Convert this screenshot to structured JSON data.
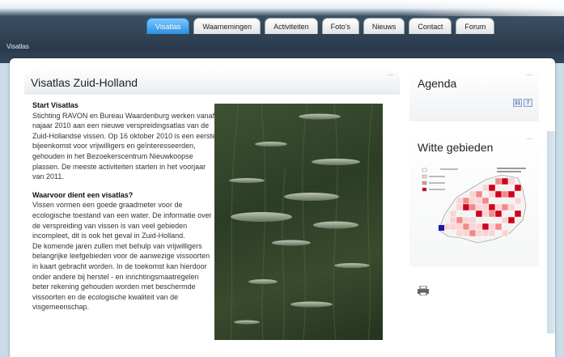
{
  "nav": {
    "tabs": [
      {
        "label": "Visatlas",
        "active": true
      },
      {
        "label": "Waarnemingen",
        "active": false
      },
      {
        "label": "Activiteiten",
        "active": false
      },
      {
        "label": "Foto's",
        "active": false
      },
      {
        "label": "Nieuws",
        "active": false
      },
      {
        "label": "Contact",
        "active": false
      },
      {
        "label": "Forum",
        "active": false
      }
    ]
  },
  "site_label": "Visatlas",
  "main": {
    "title": "Visatlas Zuid-Holland",
    "section1": {
      "heading": "Start Visatlas",
      "body": "Stichting RAVON en Bureau Waardenburg werken vanaf najaar 2010 aan een nieuwe verspreidingsatlas van de Zuid-Hollandse vissen. Op 16 oktober 2010 is een eerste bijeenkomst voor vrijwilligers en geïnteresseerden, gehouden in het Bezoekerscentrum Nieuwkoopse plassen. De meeste activiteiten starten in het voorjaar van 2011."
    },
    "section2": {
      "heading": "Waarvoor dient een visatlas?",
      "body1": "Vissen vormen een goede graadmeter voor de ecologische toestand van een water. De informatie over de verspreiding van vissen is van veel gebieden incompleet, dit is ook het geval in Zuid-Holland.",
      "body2": "De komende jaren zullen met behulp van vrijwilligers belangrijke leefgebieden voor de aanwezige vissoorten in kaart gebracht worden. In de toekomst kan hierdoor onder andere bij herstel - en inrichtingsmaatregelen beter rekening gehouden worden met beschermde vissoorten en de ecologische kwaliteit van de visgemeenschap."
    }
  },
  "agenda": {
    "title": "Agenda",
    "icon1": "31",
    "icon2": "7"
  },
  "witte": {
    "title": "Witte gebieden"
  },
  "colors": {
    "nav_active": "#2b8fe0",
    "header_dark": "#2a3a4c",
    "map_red": "#d0021b"
  }
}
